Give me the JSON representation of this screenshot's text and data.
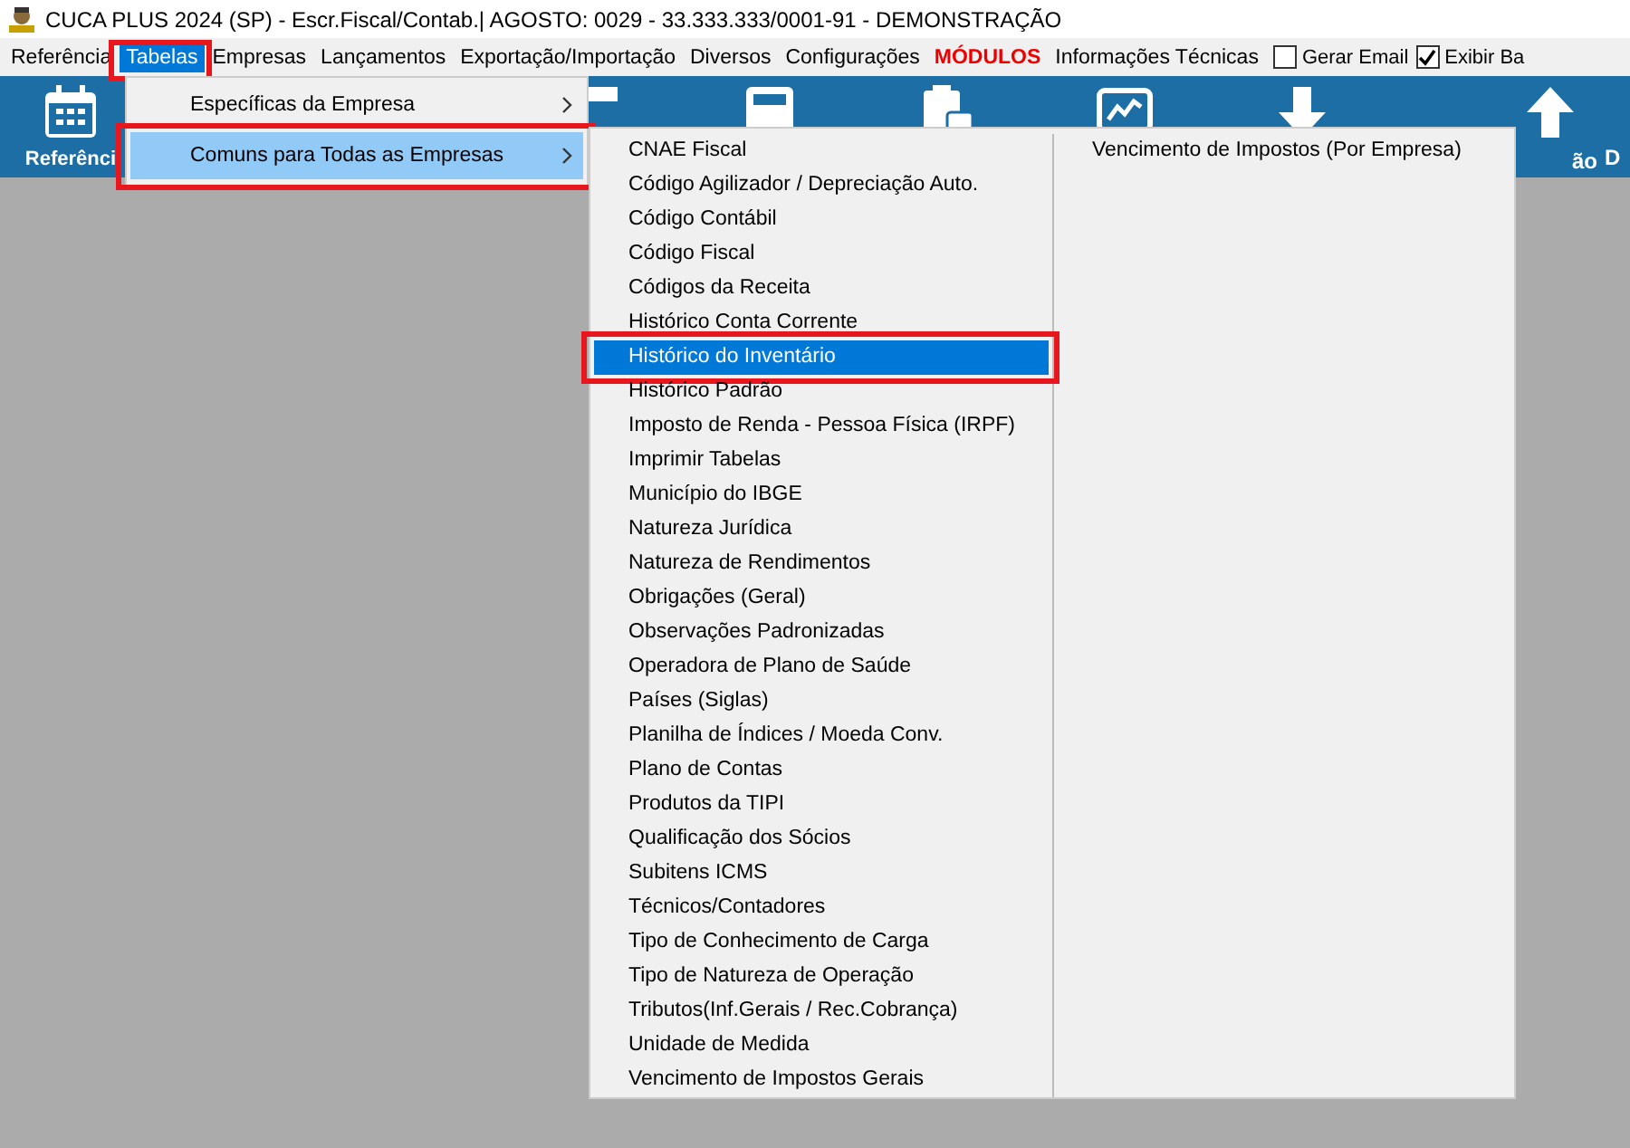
{
  "window": {
    "title": "CUCA PLUS 2024 (SP) - Escr.Fiscal/Contab.| AGOSTO: 0029 - 33.333.333/0001-91 - DEMONSTRAÇÃO"
  },
  "menu_bar": [
    {
      "kind": "menu",
      "label": "Referência",
      "selected": false,
      "highlighted": false
    },
    {
      "kind": "menu",
      "label": "Tabelas",
      "selected": true,
      "highlighted": true
    },
    {
      "kind": "menu",
      "label": "Empresas",
      "selected": false,
      "highlighted": false
    },
    {
      "kind": "menu",
      "label": "Lançamentos",
      "selected": false,
      "highlighted": false
    },
    {
      "kind": "menu",
      "label": "Exportação/Importação",
      "selected": false,
      "highlighted": false
    },
    {
      "kind": "menu",
      "label": "Diversos",
      "selected": false,
      "highlighted": false
    },
    {
      "kind": "menu",
      "label": "Configurações",
      "selected": false,
      "highlighted": false
    },
    {
      "kind": "emphasis",
      "label": "MÓDULOS",
      "selected": false,
      "highlighted": false
    },
    {
      "kind": "menu",
      "label": "Informações Técnicas",
      "selected": false,
      "highlighted": false
    }
  ],
  "checkboxes": [
    {
      "label": "Gerar Email",
      "checked": false
    },
    {
      "label": "Exibir Ba",
      "checked": true
    }
  ],
  "toolbar": [
    {
      "kind": "calendar",
      "label": "Referênci"
    },
    {
      "kind": "bar"
    },
    {
      "kind": "calculator"
    },
    {
      "kind": "clipboard"
    },
    {
      "kind": "chart"
    },
    {
      "kind": "down"
    },
    {
      "kind": "up",
      "label": "ão"
    },
    {
      "kind": "blank",
      "label": "D"
    }
  ],
  "dropdown": {
    "items": [
      {
        "label": "Específicas da Empresa",
        "selected": false,
        "highlighted": false
      },
      {
        "label": "Comuns para Todas as Empresas",
        "selected": true,
        "highlighted": true
      }
    ]
  },
  "submenu": {
    "columns": [
      [
        {
          "label": "CNAE Fiscal",
          "selected": false,
          "highlighted": false
        },
        {
          "label": "Código Agilizador / Depreciação Auto.",
          "selected": false,
          "highlighted": false
        },
        {
          "label": "Código Contábil",
          "selected": false,
          "highlighted": false
        },
        {
          "label": "Código Fiscal",
          "selected": false,
          "highlighted": false
        },
        {
          "label": "Códigos da Receita",
          "selected": false,
          "highlighted": false
        },
        {
          "label": "Histórico Conta Corrente",
          "selected": false,
          "highlighted": false
        },
        {
          "label": "Histórico do Inventário",
          "selected": true,
          "highlighted": true
        },
        {
          "label": "Histórico Padrão",
          "selected": false,
          "highlighted": false
        },
        {
          "label": "Imposto de Renda - Pessoa Física (IRPF)",
          "selected": false,
          "highlighted": false
        },
        {
          "label": "Imprimir Tabelas",
          "selected": false,
          "highlighted": false
        },
        {
          "label": "Município do IBGE",
          "selected": false,
          "highlighted": false
        },
        {
          "label": "Natureza Jurídica",
          "selected": false,
          "highlighted": false
        },
        {
          "label": "Natureza de Rendimentos",
          "selected": false,
          "highlighted": false
        },
        {
          "label": "Obrigações (Geral)",
          "selected": false,
          "highlighted": false
        },
        {
          "label": "Observações Padronizadas",
          "selected": false,
          "highlighted": false
        },
        {
          "label": "Operadora de Plano de Saúde",
          "selected": false,
          "highlighted": false
        },
        {
          "label": "Países (Siglas)",
          "selected": false,
          "highlighted": false
        },
        {
          "label": "Planilha de Índices / Moeda Conv.",
          "selected": false,
          "highlighted": false
        },
        {
          "label": "Plano de Contas",
          "selected": false,
          "highlighted": false
        },
        {
          "label": "Produtos da TIPI",
          "selected": false,
          "highlighted": false
        },
        {
          "label": "Qualificação dos Sócios",
          "selected": false,
          "highlighted": false
        },
        {
          "label": "Subitens ICMS",
          "selected": false,
          "highlighted": false
        },
        {
          "label": "Técnicos/Contadores",
          "selected": false,
          "highlighted": false
        },
        {
          "label": "Tipo de Conhecimento de Carga",
          "selected": false,
          "highlighted": false
        },
        {
          "label": "Tipo de Natureza de Operação",
          "selected": false,
          "highlighted": false
        },
        {
          "label": "Tributos(Inf.Gerais / Rec.Cobrança)",
          "selected": false,
          "highlighted": false
        },
        {
          "label": "Unidade de Medida",
          "selected": false,
          "highlighted": false
        },
        {
          "label": "Vencimento de Impostos Gerais",
          "selected": false,
          "highlighted": false
        }
      ],
      [
        {
          "label": "Vencimento de Impostos (Por Empresa)",
          "selected": false,
          "highlighted": false
        }
      ]
    ]
  }
}
